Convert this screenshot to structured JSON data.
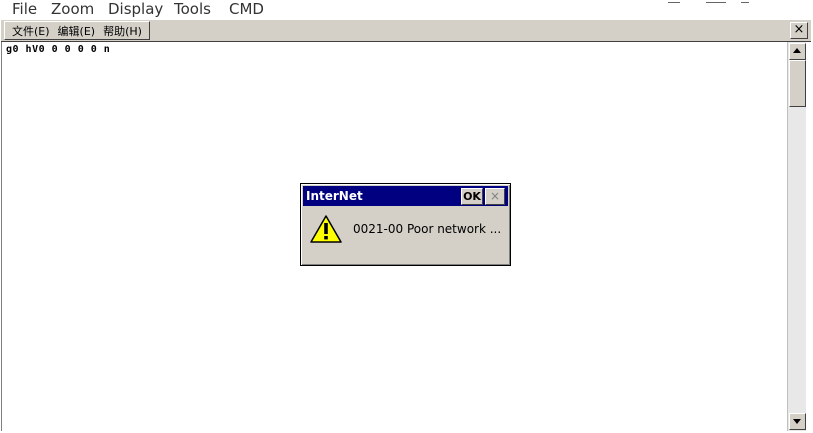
{
  "host_menu": {
    "items": [
      "File",
      "Zoom",
      "Display",
      "Tools",
      "CMD"
    ]
  },
  "window": {
    "menu": {
      "items": [
        "文件(E)",
        "编辑(E)",
        "帮助(H)"
      ]
    },
    "close_label": "×"
  },
  "terminal": {
    "line": "g0 hV0 0 0 0 0 n"
  },
  "dialog": {
    "title": "InterNet",
    "ok_label": "OK",
    "close_label": "×",
    "message": "0021-00 Poor network ...",
    "icon": "warning-icon"
  },
  "colors": {
    "titlebar": "#000080",
    "face": "#d4d0c8",
    "warning_fill": "#ffff00"
  }
}
